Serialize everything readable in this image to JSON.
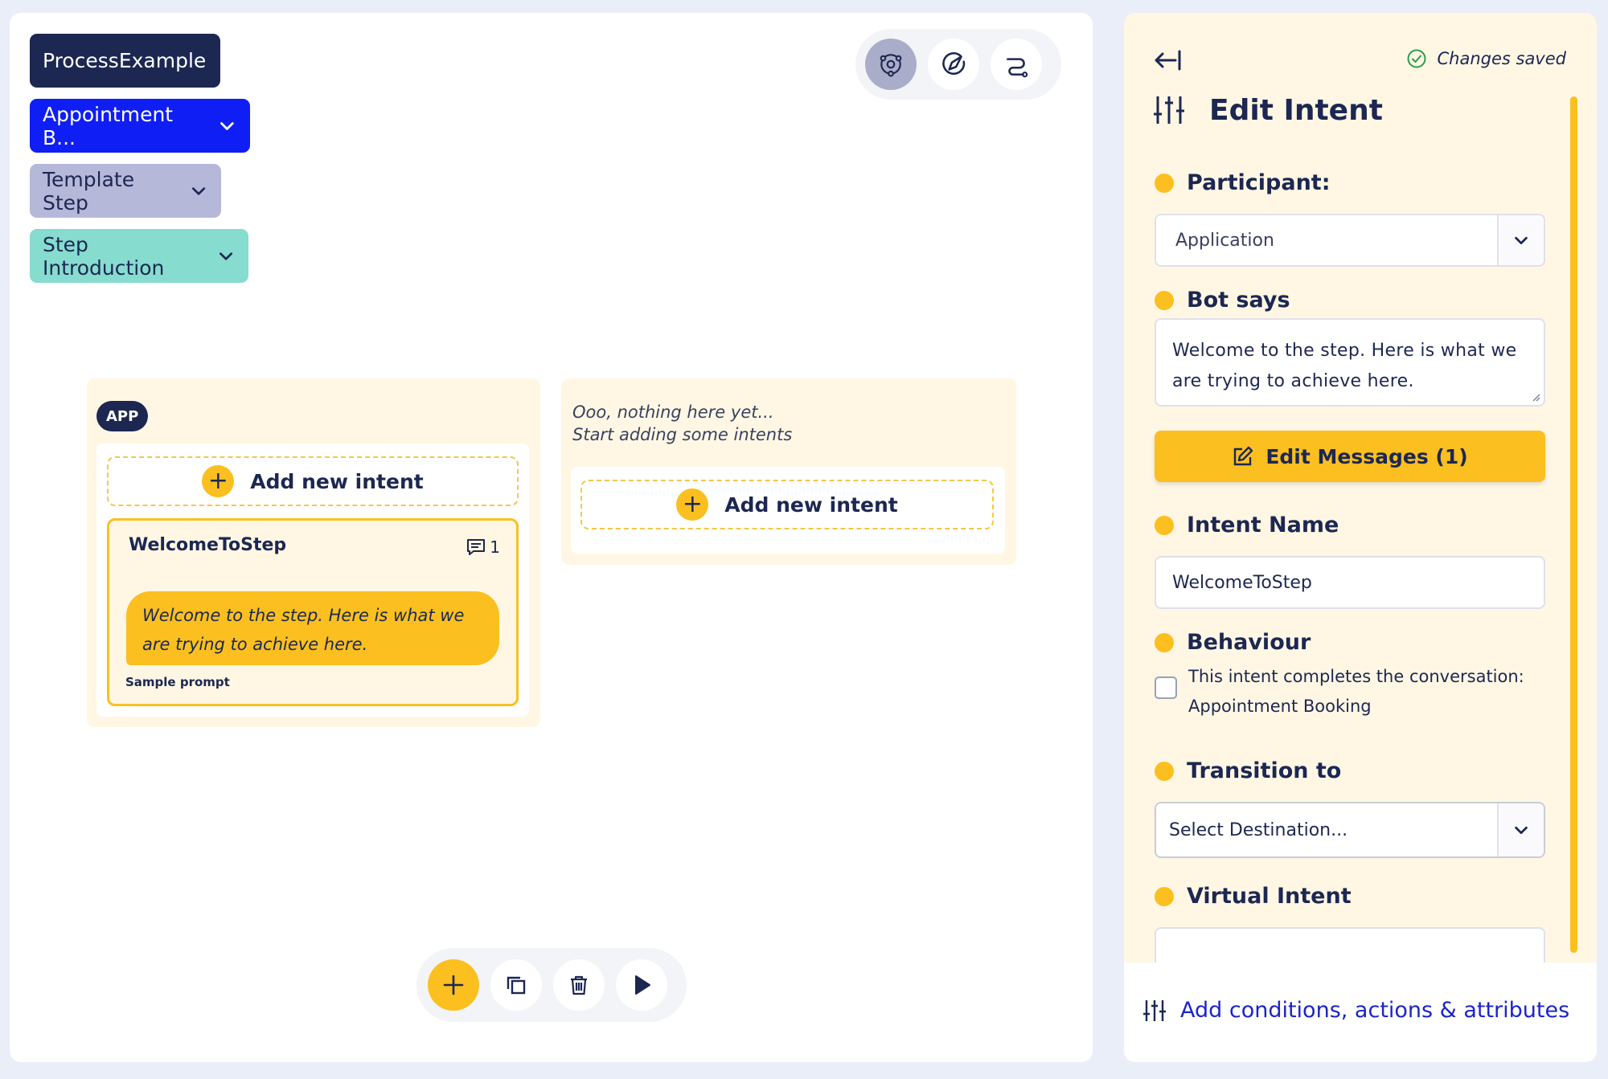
{
  "breadcrumbs": {
    "process": "ProcessExample",
    "flow": "Appointment B...",
    "template": "Template Step",
    "step": "Step Introduction"
  },
  "view_toolbar": [
    "network-view-icon",
    "compass-icon",
    "route-icon"
  ],
  "columns": {
    "app": {
      "badge": "APP",
      "add_label": "Add new intent",
      "intent": {
        "name": "WelcomeToStep",
        "message_count": "1",
        "message": "Welcome to the step. Here is what we are trying to achieve here.",
        "sample_label": "Sample prompt"
      }
    },
    "empty": {
      "line1": "Ooo, nothing here yet...",
      "line2": "Start adding some intents",
      "add_label": "Add new intent"
    }
  },
  "bottom_toolbar": [
    "plus-icon",
    "copy-icon",
    "trash-icon",
    "play-icon"
  ],
  "panel": {
    "status": "Changes saved",
    "title": "Edit Intent",
    "participant": {
      "label": "Participant:",
      "value": "Application"
    },
    "bot_says": {
      "label": "Bot says",
      "value": "Welcome to the step. Here is what we are trying to achieve here."
    },
    "edit_messages": "Edit Messages (1)",
    "intent_name": {
      "label": "Intent Name",
      "value": "WelcomeToStep"
    },
    "behaviour": {
      "label": "Behaviour",
      "checkbox_text": "This intent completes the conversation: Appointment Booking",
      "checked": false
    },
    "transition": {
      "label": "Transition to",
      "value": "Select Destination..."
    },
    "virtual_intent": {
      "label": "Virtual Intent",
      "value": ""
    },
    "footer_link": "Add conditions, actions & attributes"
  },
  "colors": {
    "navy": "#1c2752",
    "blue": "#0f1ef5",
    "lavender": "#b5b8d9",
    "teal": "#86dccf",
    "yellow": "#fbbf1f",
    "cream": "#fff7e4",
    "link": "#1b25c9"
  }
}
